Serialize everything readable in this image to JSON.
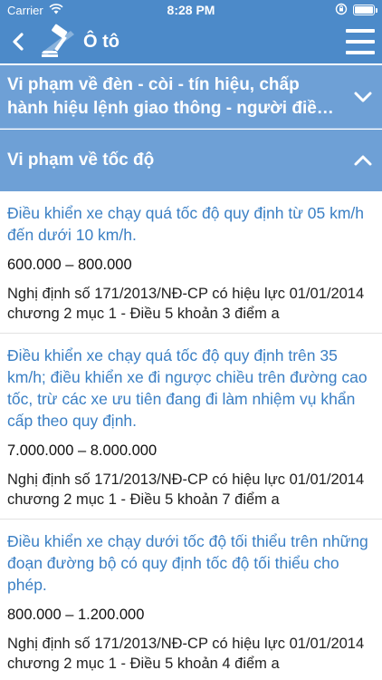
{
  "status_bar": {
    "carrier": "Carrier",
    "time": "8:28 PM",
    "battery_level": 1.0
  },
  "header": {
    "title": "Ô tô"
  },
  "sections": [
    {
      "title": "Vi phạm về đèn - còi  - tín hiệu, chấp hành hiệu lệnh giao thông - người điều khiển giao thông",
      "expanded": false
    },
    {
      "title": "Vi phạm về tốc độ",
      "expanded": true
    }
  ],
  "violations": [
    {
      "description": "Điều khiển xe chạy quá tốc độ quy định từ 05 km/h đến dưới 10 km/h.",
      "fine": "600.000 –  800.000",
      "reference": "Nghị định số 171/2013/NĐ-CP có hiệu lực 01/01/2014 chương 2 mục 1  - Điều 5 khoản 3 điểm a"
    },
    {
      "description": "Điều khiển xe chạy quá tốc độ quy định trên 35 km/h; điều khiển xe đi ngược chiều trên đường cao tốc, trừ các xe ưu tiên đang đi làm nhiệm vụ khẩn cấp theo quy định.",
      "fine": "7.000.000 –  8.000.000",
      "reference": "Nghị định số 171/2013/NĐ-CP có hiệu lực 01/01/2014 chương 2 mục 1  - Điều 5 khoản 7 điểm a"
    },
    {
      "description": "Điều khiển xe chạy dưới tốc độ tối thiểu trên những đoạn đường bộ có quy định tốc độ tối thiểu cho phép.",
      "fine": "800.000 –  1.200.000",
      "reference": "Nghị định số 171/2013/NĐ-CP có hiệu lực 01/01/2014 chương 2 mục 1  - Điều 5 khoản 4 điểm a"
    }
  ],
  "colors": {
    "nav": "#4c8ac9",
    "section": "#6ea0d6",
    "link": "#3a7fc4"
  },
  "icons": [
    "wifi-icon",
    "battery-icon",
    "back-icon",
    "gavel-logo-icon",
    "menu-icon",
    "chevron-down-icon",
    "chevron-up-icon"
  ]
}
